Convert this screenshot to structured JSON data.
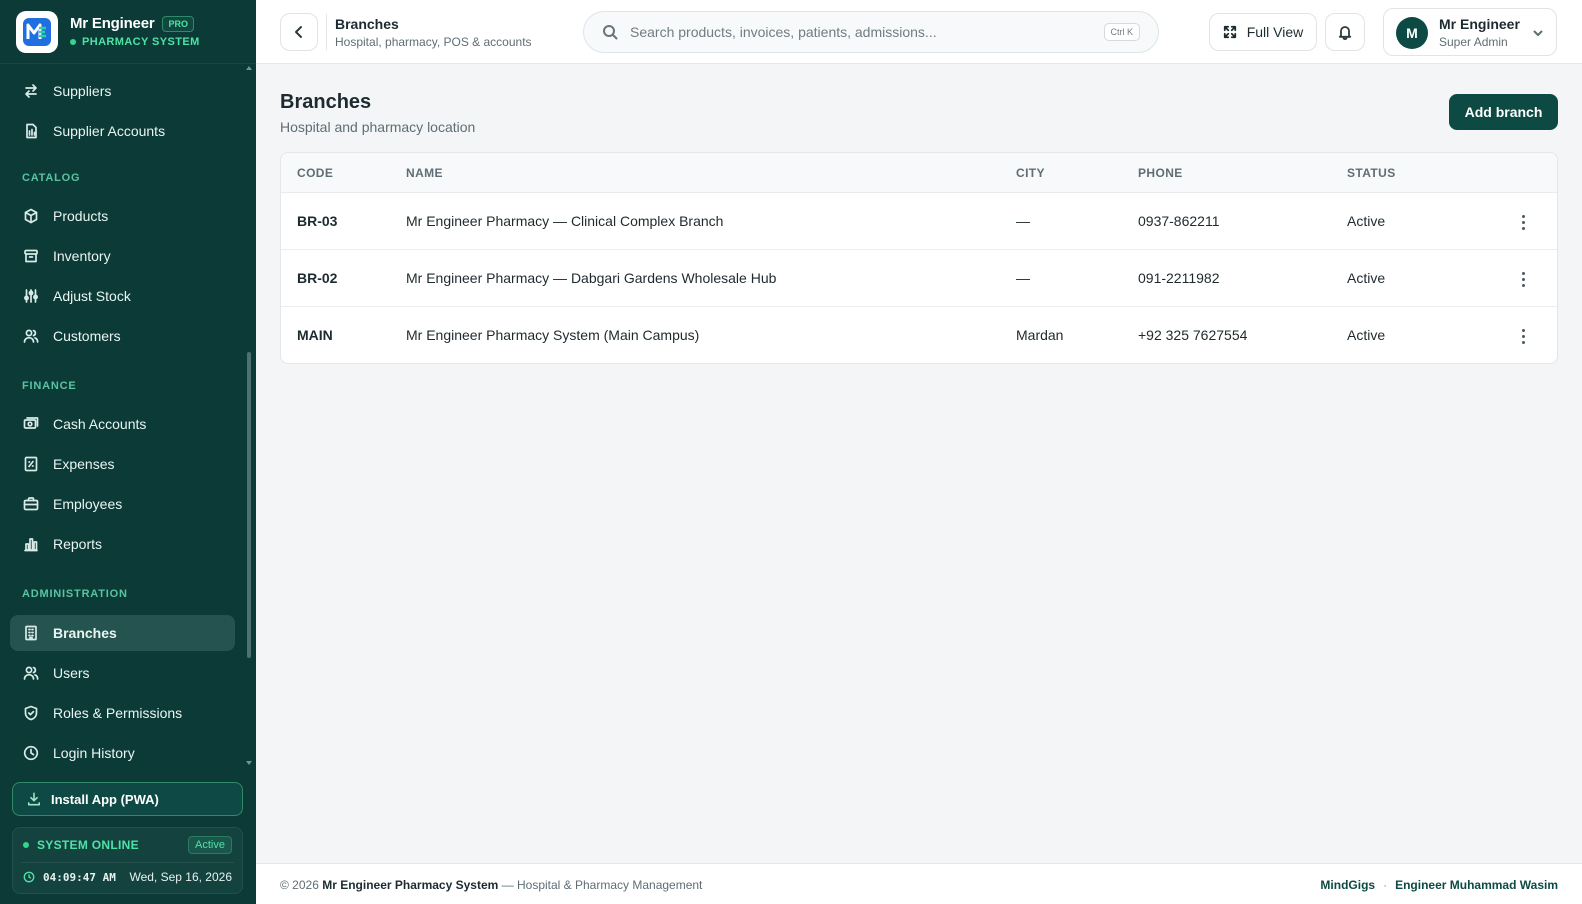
{
  "brand": {
    "name": "Mr Engineer",
    "badge": "PRO",
    "subtitle": "PHARMACY SYSTEM",
    "accent": "#4ee3a6",
    "sidebar_bg": "#0b3a37"
  },
  "sidebar": {
    "sections": [
      {
        "label": "",
        "items": [
          {
            "label": "Suppliers",
            "icon": "arrows-swap-icon"
          },
          {
            "label": "Supplier Accounts",
            "icon": "document-icon"
          }
        ]
      },
      {
        "label": "CATALOG",
        "items": [
          {
            "label": "Products",
            "icon": "package-icon"
          },
          {
            "label": "Inventory",
            "icon": "archive-icon"
          },
          {
            "label": "Adjust Stock",
            "icon": "sliders-icon"
          },
          {
            "label": "Customers",
            "icon": "users-icon"
          }
        ]
      },
      {
        "label": "FINANCE",
        "items": [
          {
            "label": "Cash Accounts",
            "icon": "cash-icon"
          },
          {
            "label": "Expenses",
            "icon": "receipt-icon"
          },
          {
            "label": "Employees",
            "icon": "briefcase-icon"
          },
          {
            "label": "Reports",
            "icon": "bar-chart-icon"
          }
        ]
      },
      {
        "label": "ADMINISTRATION",
        "items": [
          {
            "label": "Branches",
            "icon": "building-icon",
            "active": true
          },
          {
            "label": "Users",
            "icon": "users-icon"
          },
          {
            "label": "Roles & Permissions",
            "icon": "shield-icon"
          },
          {
            "label": "Login History",
            "icon": "clock-icon"
          }
        ]
      }
    ],
    "install_label": "Install App (PWA)",
    "system_status": "SYSTEM ONLINE",
    "status_badge": "Active",
    "time": "04:09:47 AM",
    "date": "Wed, Sep 16, 2026"
  },
  "header": {
    "title": "Branches",
    "subtitle": "Hospital, pharmacy, POS & accounts",
    "search_placeholder": "Search products, invoices, patients, admissions...",
    "shortcut": "Ctrl K",
    "full_view_label": "Full View",
    "user": {
      "initial": "M",
      "name": "Mr Engineer",
      "role": "Super Admin"
    }
  },
  "main": {
    "title": "Branches",
    "subtitle": "Hospital and pharmacy location",
    "add_label": "Add branch",
    "columns": [
      "CODE",
      "NAME",
      "CITY",
      "PHONE",
      "STATUS"
    ],
    "rows": [
      {
        "code": "BR-03",
        "name": "Mr Engineer Pharmacy — Clinical Complex Branch",
        "city": "—",
        "phone": "0937-862211",
        "status": "Active"
      },
      {
        "code": "BR-02",
        "name": "Mr Engineer Pharmacy — Dabgari Gardens Wholesale Hub",
        "city": "—",
        "phone": "091-2211982",
        "status": "Active"
      },
      {
        "code": "MAIN",
        "name": "Mr Engineer Pharmacy System (Main Campus)",
        "city": "Mardan",
        "phone": "+92 325 7627554",
        "status": "Active"
      }
    ]
  },
  "footer": {
    "copyright": "© 2026",
    "product": "Mr Engineer Pharmacy System",
    "tagline": "— Hospital & Pharmacy Management",
    "link1": "MindGigs",
    "separator": "·",
    "link2": "Engineer Muhammad Wasim"
  }
}
